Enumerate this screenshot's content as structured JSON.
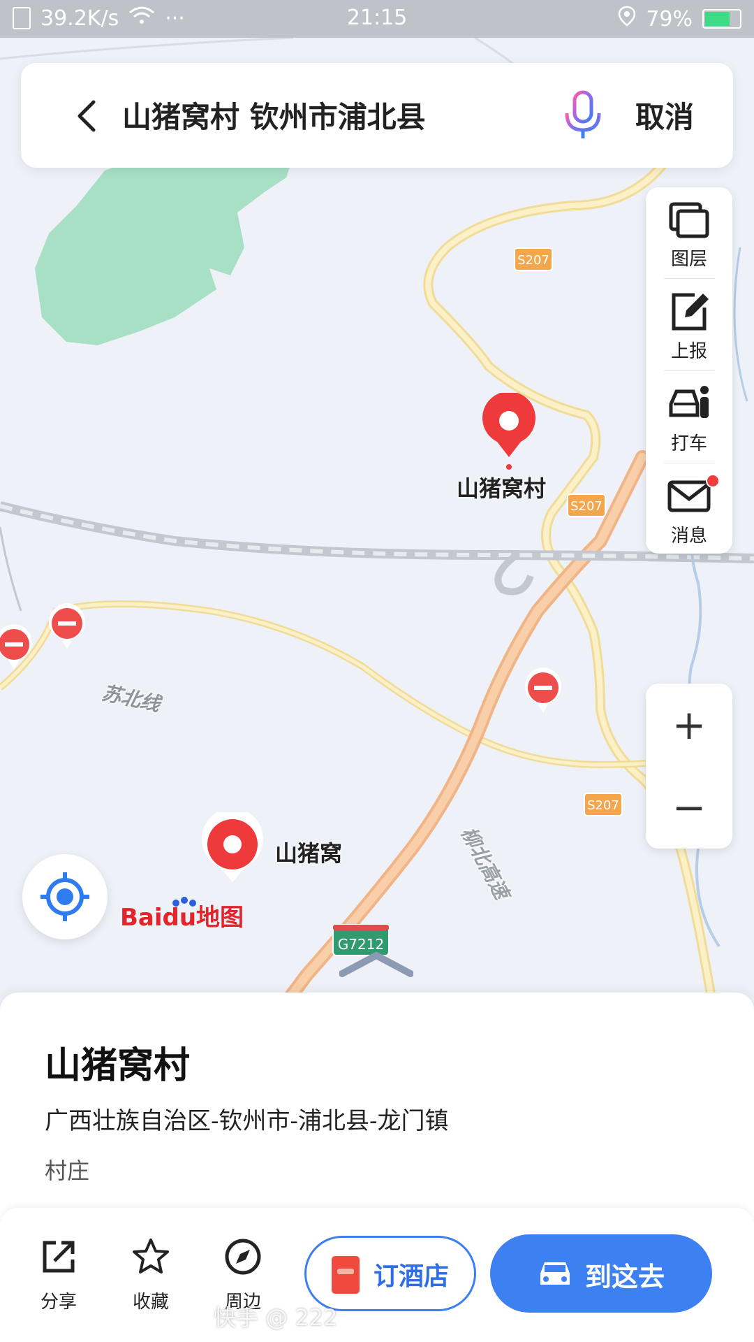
{
  "status_bar": {
    "speed": "39.2K/s",
    "dots": "···",
    "time": "21:15",
    "battery": "79%",
    "battery_level": 0.79
  },
  "search": {
    "query": "山猪窝村 钦州市浦北县",
    "cancel_label": "取消"
  },
  "tools": {
    "layers_label": "图层",
    "report_label": "上报",
    "taxi_label": "打车",
    "messages_label": "消息"
  },
  "zoom": {
    "in_label": "+",
    "out_label": "−"
  },
  "map": {
    "labels": {
      "poi_main": "山猪窝村",
      "poi_secondary": "山猪窝",
      "rail": "苏北线",
      "highway": "柳北高速",
      "road_s207_a": "S207",
      "road_s207_b": "S207",
      "road_s207_c": "S207",
      "road_g7212": "G7212"
    },
    "logo_text": "Baidu地图",
    "colors": {
      "land": "#eef1f8",
      "green_area": "#a8e0c6",
      "expressway": "#f6c59a",
      "provincial_road": "#f7e7a8",
      "railway": "#c8ccd4",
      "pin_red": "#f23b3b"
    }
  },
  "place": {
    "name": "山猪窝村",
    "address": "广西壮族自治区-钦州市-浦北县-龙门镇",
    "category": "村庄"
  },
  "actions": {
    "share_label": "分享",
    "favorite_label": "收藏",
    "nearby_label": "周边",
    "hotel_label": "订酒店",
    "go_label": "到这去"
  },
  "watermark": "快手 @ 222",
  "colors": {
    "accent": "#3d80f2"
  }
}
